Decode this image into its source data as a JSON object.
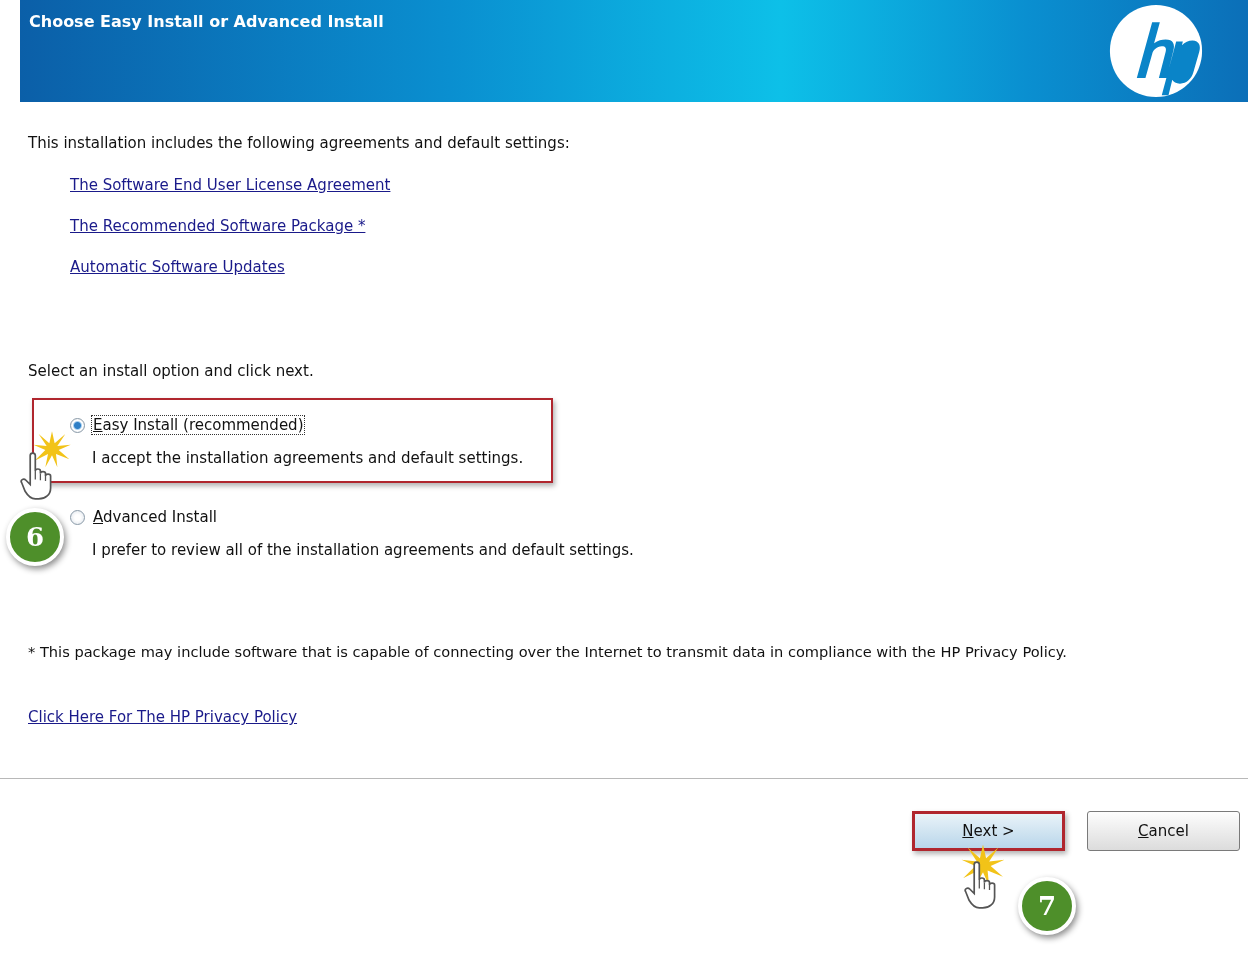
{
  "header": {
    "title": "Choose Easy Install or Advanced Install"
  },
  "intro": "This installation includes the following agreements and default settings:",
  "links": [
    {
      "text": "The Software End User License Agreement"
    },
    {
      "text": "The Recommended Software Package *"
    },
    {
      "text": "Automatic Software Updates"
    }
  ],
  "prompt": "Select an install option and click next.",
  "options": [
    {
      "label": "Easy Install (recommended)",
      "description": "I accept the installation agreements and default settings.",
      "selected": true,
      "focused": true,
      "highlighted": true,
      "callout": "6"
    },
    {
      "label": "Advanced Install",
      "description": "I prefer to review all of the installation agreements and default settings.",
      "selected": false,
      "focused": false,
      "highlighted": false
    }
  ],
  "footnote": "* This package may include software that is capable of connecting over the Internet to transmit data in compliance with the HP Privacy Policy.",
  "privacy_link": "Click Here For The HP Privacy Policy",
  "buttons": [
    {
      "label": "Next >",
      "highlighted": true,
      "callout": "7"
    },
    {
      "label": "Cancel",
      "highlighted": false
    }
  ]
}
